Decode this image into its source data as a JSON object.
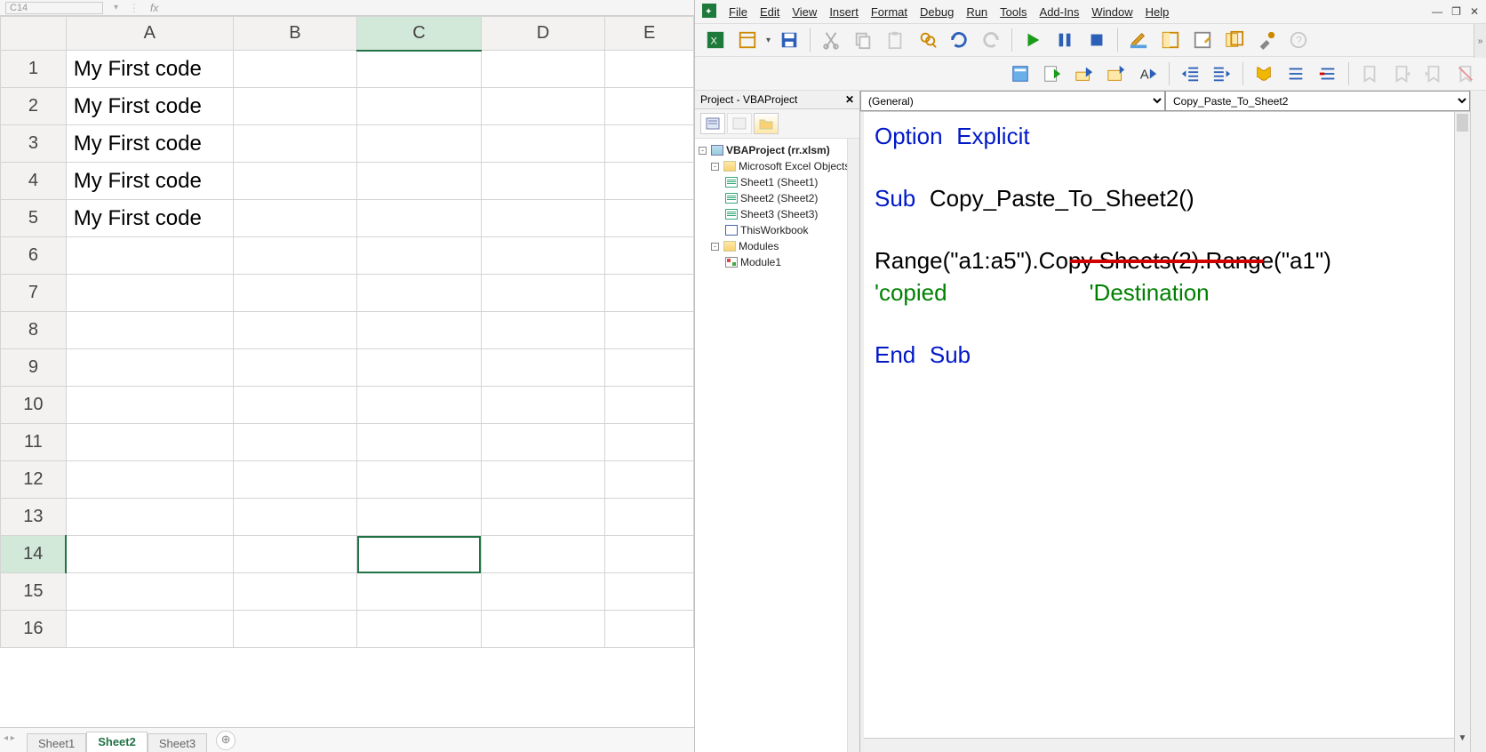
{
  "excel": {
    "namebox": "C14",
    "fx_label": "fx",
    "col_headers": [
      "A",
      "B",
      "C",
      "D",
      "E"
    ],
    "row_headers": [
      "1",
      "2",
      "3",
      "4",
      "5",
      "6",
      "7",
      "8",
      "9",
      "10",
      "11",
      "12",
      "13",
      "14",
      "15",
      "16"
    ],
    "cells_A": [
      "My First code",
      "My First code",
      "My First code",
      "My First code",
      "My First code"
    ],
    "active_cell": {
      "row": 14,
      "col": "C"
    },
    "tabs": [
      "Sheet1",
      "Sheet2",
      "Sheet3"
    ],
    "active_tab": "Sheet2",
    "add_tab_glyph": "⊕"
  },
  "vba": {
    "menus": [
      "File",
      "Edit",
      "View",
      "Insert",
      "Format",
      "Debug",
      "Run",
      "Tools",
      "Add-Ins",
      "Window",
      "Help"
    ],
    "project_pane_title": "Project - VBAProject",
    "tree": {
      "root": "VBAProject (rr.xlsm)",
      "excel_objects_label": "Microsoft Excel Objects",
      "sheets": [
        "Sheet1 (Sheet1)",
        "Sheet2 (Sheet2)",
        "Sheet3 (Sheet3)"
      ],
      "thisworkbook": "ThisWorkbook",
      "modules_label": "Modules",
      "module1": "Module1"
    },
    "dd_left": "(General)",
    "dd_right": "Copy_Paste_To_Sheet2",
    "code": {
      "l1a": "Option",
      "l1b": "Explicit",
      "l3a": "Sub",
      "l3b": "Copy_Paste_To_Sheet2()",
      "l5": "Range(\"a1:a5\").Copy Sheets(2).Range(\"a1\")",
      "l6a": "'copied",
      "l6b": "'Destination",
      "l8a": "End",
      "l8b": "Sub"
    }
  }
}
